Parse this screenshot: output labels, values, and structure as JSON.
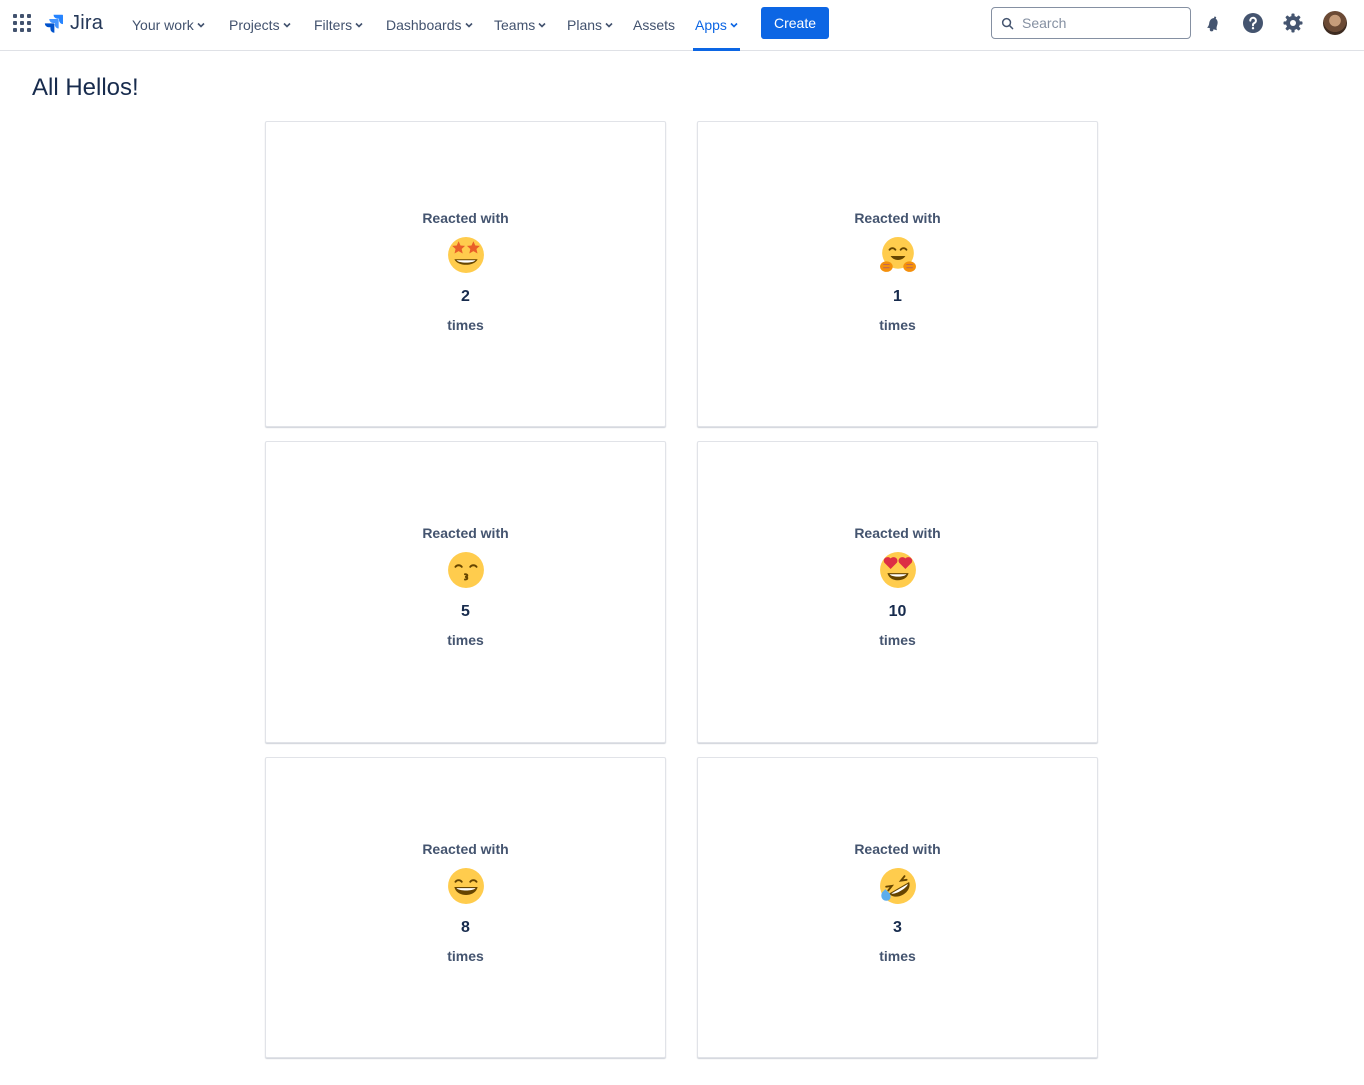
{
  "nav": {
    "logo_text": "Jira",
    "items": [
      {
        "label": "Your work",
        "dropdown": true,
        "active": false
      },
      {
        "label": "Projects",
        "dropdown": true,
        "active": false
      },
      {
        "label": "Filters",
        "dropdown": true,
        "active": false
      },
      {
        "label": "Dashboards",
        "dropdown": true,
        "active": false
      },
      {
        "label": "Teams",
        "dropdown": true,
        "active": false
      },
      {
        "label": "Plans",
        "dropdown": true,
        "active": false
      },
      {
        "label": "Assets",
        "dropdown": false,
        "active": false
      },
      {
        "label": "Apps",
        "dropdown": true,
        "active": true
      }
    ],
    "create_label": "Create",
    "search_placeholder": "Search",
    "search_value": "",
    "accent_color": "#0c66e4"
  },
  "page": {
    "title": "All Hellos!"
  },
  "cards": [
    {
      "reacted_label": "Reacted with",
      "emoji": "star-struck",
      "count": "2",
      "times_label": "times"
    },
    {
      "reacted_label": "Reacted with",
      "emoji": "hugging-face",
      "count": "1",
      "times_label": "times"
    },
    {
      "reacted_label": "Reacted with",
      "emoji": "kissing-smiling-eyes",
      "count": "5",
      "times_label": "times"
    },
    {
      "reacted_label": "Reacted with",
      "emoji": "heart-eyes",
      "count": "10",
      "times_label": "times"
    },
    {
      "reacted_label": "Reacted with",
      "emoji": "grinning-smiling-eyes",
      "count": "8",
      "times_label": "times"
    },
    {
      "reacted_label": "Reacted with",
      "emoji": "rolling-on-floor-laughing",
      "count": "3",
      "times_label": "times"
    }
  ]
}
